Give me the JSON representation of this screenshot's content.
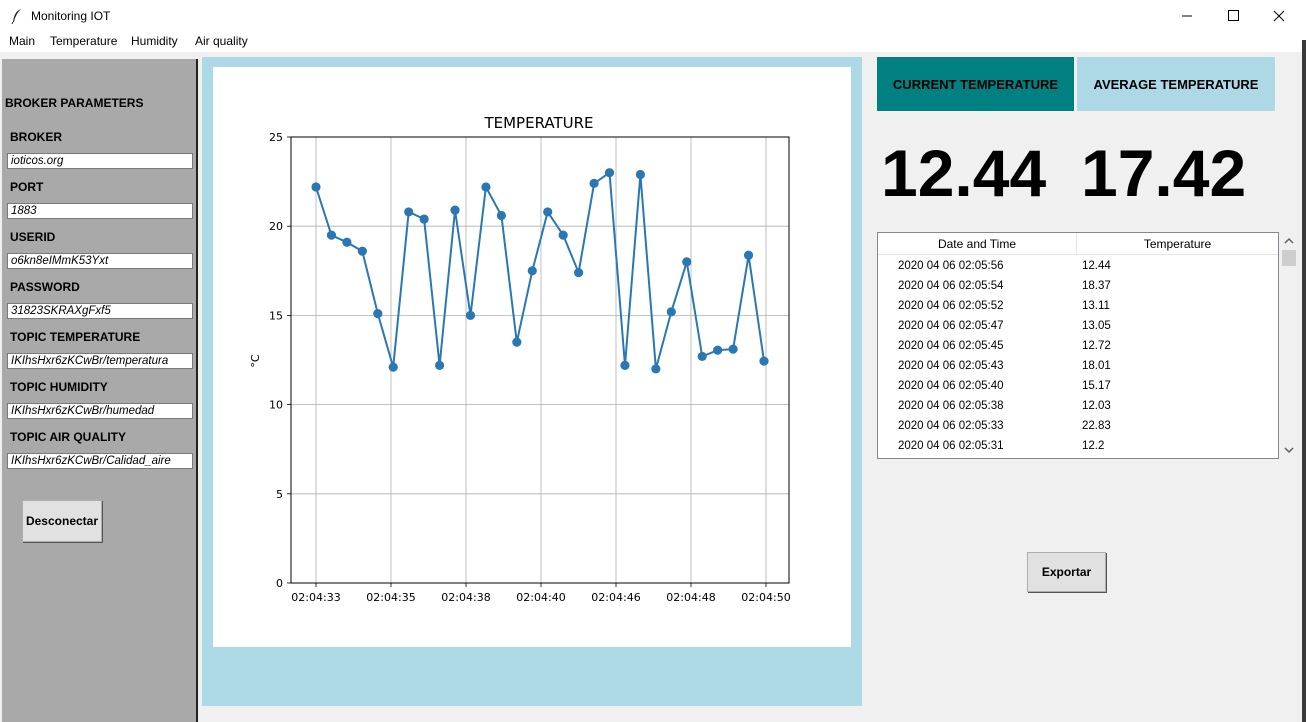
{
  "window": {
    "title": "Monitoring IOT",
    "icon": "feather-icon",
    "controls": [
      "minimize-icon",
      "maximize-icon",
      "close-icon"
    ]
  },
  "menu": {
    "items": [
      "Main",
      "Temperature",
      "Humidity",
      "Air quality"
    ]
  },
  "sidebar": {
    "title": "BROKER PARAMETERS",
    "fields": [
      {
        "label": "BROKER",
        "value": "ioticos.org"
      },
      {
        "label": "PORT",
        "value": "1883"
      },
      {
        "label": "USERID",
        "value": "o6kn8eIMmK53Yxt"
      },
      {
        "label": "PASSWORD",
        "value": "31823SKRAXgFxf5"
      },
      {
        "label": "TOPIC TEMPERATURE",
        "value": "IKIhsHxr6zKCwBr/temperatura"
      },
      {
        "label": "TOPIC HUMIDITY",
        "value": "IKIhsHxr6zKCwBr/humedad"
      },
      {
        "label": "TOPIC AIR QUALITY",
        "value": "IKIhsHxr6zKCwBr/Calidad_aire"
      }
    ],
    "disconnect_label": "Desconectar",
    "background": "#a9a9a9"
  },
  "tabs": {
    "current_label": "CURRENT TEMPERATURE",
    "average_label": "AVERAGE TEMPERATURE",
    "current_color": "#008080",
    "average_color": "#add8e6"
  },
  "readings": {
    "current": "12.44",
    "average": "17.42"
  },
  "table": {
    "headers": [
      "Date and Time",
      "Temperature"
    ],
    "rows": [
      [
        "2020 04 06 02:05:56",
        "12.44"
      ],
      [
        "2020 04 06 02:05:54",
        "18.37"
      ],
      [
        "2020 04 06 02:05:52",
        "13.11"
      ],
      [
        "2020 04 06 02:05:47",
        "13.05"
      ],
      [
        "2020 04 06 02:05:45",
        "12.72"
      ],
      [
        "2020 04 06 02:05:43",
        "18.01"
      ],
      [
        "2020 04 06 02:05:40",
        "15.17"
      ],
      [
        "2020 04 06 02:05:38",
        "12.03"
      ],
      [
        "2020 04 06 02:05:33",
        "22.83"
      ],
      [
        "2020 04 06 02:05:31",
        "12.2"
      ]
    ]
  },
  "export_label": "Exportar",
  "chart_data": {
    "type": "line",
    "title": "TEMPERATURE",
    "ylabel": "°C",
    "xlabel": "",
    "ylim": [
      0,
      25
    ],
    "yticks": [
      0,
      5,
      10,
      15,
      20,
      25
    ],
    "xtick_labels": [
      "02:04:33",
      "02:04:35",
      "02:04:38",
      "02:04:40",
      "02:04:46",
      "02:04:48",
      "02:04:50"
    ],
    "grid": true,
    "marker": "circle",
    "color": "#2a77b4",
    "y": [
      22.2,
      19.5,
      19.1,
      18.6,
      15.1,
      12.1,
      20.8,
      20.4,
      12.2,
      20.9,
      15.0,
      22.2,
      20.6,
      13.5,
      17.5,
      20.8,
      19.5,
      17.4,
      22.4,
      23.0,
      12.2,
      22.9,
      12.0,
      15.2,
      18.0,
      12.7,
      13.05,
      13.11,
      18.37,
      12.44
    ]
  }
}
